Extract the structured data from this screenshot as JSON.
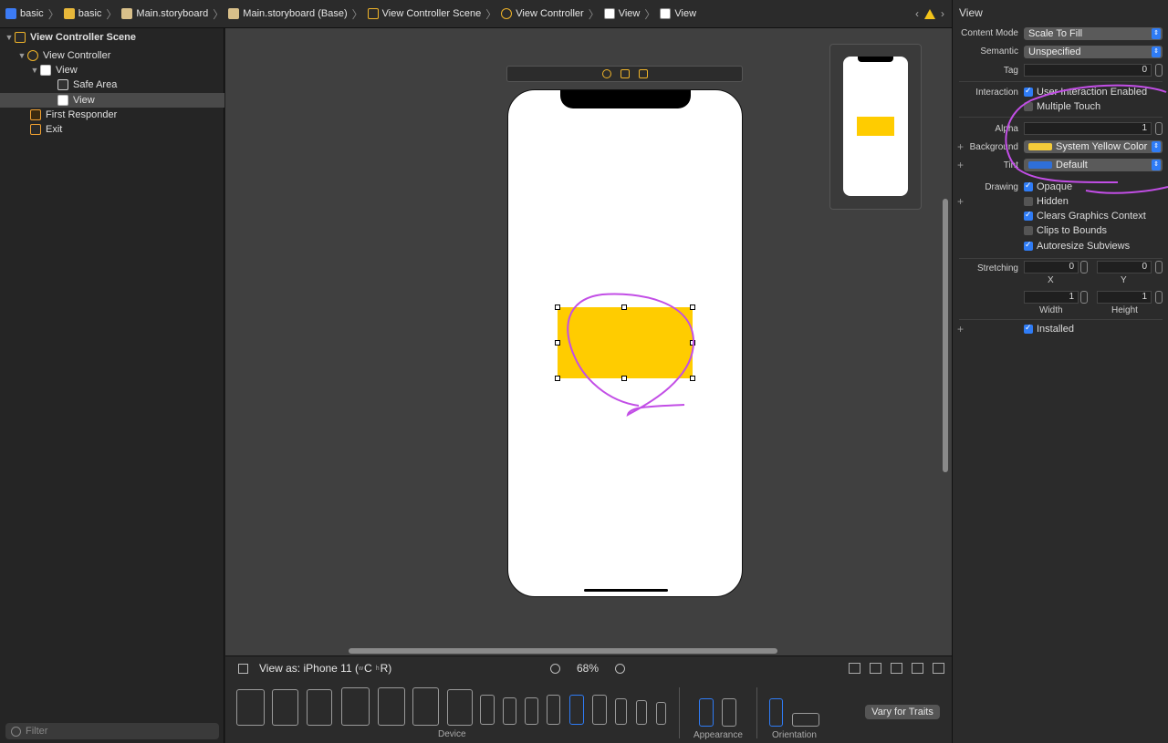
{
  "breadcrumb": {
    "items": [
      {
        "label": "basic",
        "icon": "project-icon",
        "color": "#3c7bf5"
      },
      {
        "label": "basic",
        "icon": "folder-icon",
        "color": "#e8b83a"
      },
      {
        "label": "Main.storyboard",
        "icon": "storyboard-file-icon",
        "color": "#d9c08a"
      },
      {
        "label": "Main.storyboard (Base)",
        "icon": "storyboard-file-icon",
        "color": "#d9c08a"
      },
      {
        "label": "View Controller Scene",
        "icon": "scene-icon",
        "color": "#f0b429"
      },
      {
        "label": "View Controller",
        "icon": "view-controller-icon",
        "color": "#f0b429"
      },
      {
        "label": "View",
        "icon": "view-icon",
        "color": "#ffffff"
      },
      {
        "label": "View",
        "icon": "view-icon",
        "color": "#ffffff"
      }
    ]
  },
  "navigator": {
    "items": [
      {
        "label": "View Controller Scene",
        "icon": "scene-icon"
      },
      {
        "label": "View Controller",
        "icon": "view-controller-icon"
      },
      {
        "label": "View",
        "icon": "view-icon"
      },
      {
        "label": "Safe Area",
        "icon": "safe-area-icon"
      },
      {
        "label": "View",
        "icon": "view-icon",
        "selected": true
      },
      {
        "label": "First Responder",
        "icon": "first-responder-icon"
      },
      {
        "label": "Exit",
        "icon": "exit-icon"
      }
    ],
    "filter_placeholder": "Filter"
  },
  "canvas": {
    "view_as": "View as: iPhone 11 (",
    "size_class_w": "w",
    "size_class_c": "C",
    "size_class_h": "h",
    "size_class_r": "R)",
    "zoom": "68%",
    "yellow_color": "#ffcc00",
    "annotation_color": "#c24ee6"
  },
  "device_bar": {
    "device_label": "Device",
    "appearance_label": "Appearance",
    "orientation_label": "Orientation",
    "vary_button": "Vary for Traits",
    "selected_color": "#2f7cf6"
  },
  "inspector": {
    "title": "View",
    "content_mode_label": "Content Mode",
    "content_mode_value": "Scale To Fill",
    "semantic_label": "Semantic",
    "semantic_value": "Unspecified",
    "tag_label": "Tag",
    "tag_value": "0",
    "interaction_label": "Interaction",
    "user_interaction": "User Interaction Enabled",
    "multiple_touch": "Multiple Touch",
    "alpha_label": "Alpha",
    "alpha_value": "1",
    "background_label": "Background",
    "background_value": "System Yellow Color",
    "tint_label": "Tint",
    "tint_value": "Default",
    "drawing_label": "Drawing",
    "opaque": "Opaque",
    "hidden": "Hidden",
    "clears_graphics": "Clears Graphics Context",
    "clips_to_bounds": "Clips to Bounds",
    "autoresize": "Autoresize Subviews",
    "stretching_label": "Stretching",
    "stretch_x": "0",
    "stretch_y": "0",
    "stretch_w": "1",
    "stretch_h": "1",
    "x_label": "X",
    "y_label": "Y",
    "width_label": "Width",
    "height_label": "Height",
    "installed": "Installed",
    "background_swatch": "#f5cc3a",
    "tint_swatch": "#2f6fd8"
  }
}
